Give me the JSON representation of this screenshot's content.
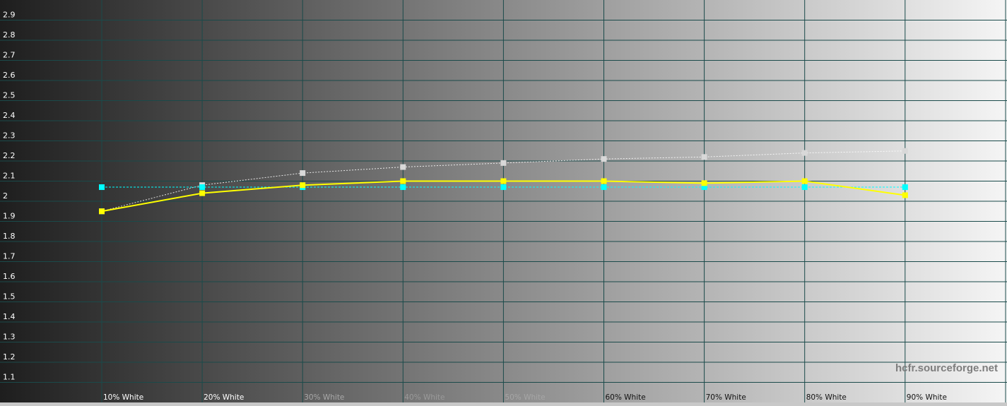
{
  "chart_data": {
    "type": "line",
    "title": "",
    "xlabel": "",
    "ylabel": "",
    "categories": [
      "10% White",
      "20% White",
      "30% White",
      "40% White",
      "50% White",
      "60% White",
      "70% White",
      "80% White",
      "90% White"
    ],
    "ylim": [
      1.0,
      3.0
    ],
    "yticks": [
      "1.1",
      "1.2",
      "1.3",
      "1.4",
      "1.5",
      "1.6",
      "1.7",
      "1.8",
      "1.9",
      "2",
      "2.1",
      "2.2",
      "2.3",
      "2.4",
      "2.5",
      "2.6",
      "2.7",
      "2.8",
      "2.9"
    ],
    "grid": true,
    "series": [
      {
        "color": "#ffff00",
        "style": "solid",
        "marker": "square",
        "values": [
          1.95,
          2.04,
          2.08,
          2.1,
          2.1,
          2.1,
          2.09,
          2.1,
          2.03
        ]
      },
      {
        "color": "#00ffff",
        "style": "dashed",
        "marker": "square",
        "values": [
          2.07,
          2.07,
          2.07,
          2.07,
          2.07,
          2.07,
          2.07,
          2.07,
          2.07
        ]
      },
      {
        "color": "#ffffff",
        "style": "dotted",
        "marker": "square",
        "values": [
          1.95,
          2.08,
          2.14,
          2.17,
          2.19,
          2.21,
          2.22,
          2.24,
          2.25
        ]
      }
    ]
  },
  "watermark": "hcfr.sourceforge.net",
  "colors": {
    "grid": "#1a4a4a",
    "background_start": "#1e1e1e",
    "background_end": "#f5f5f5"
  }
}
